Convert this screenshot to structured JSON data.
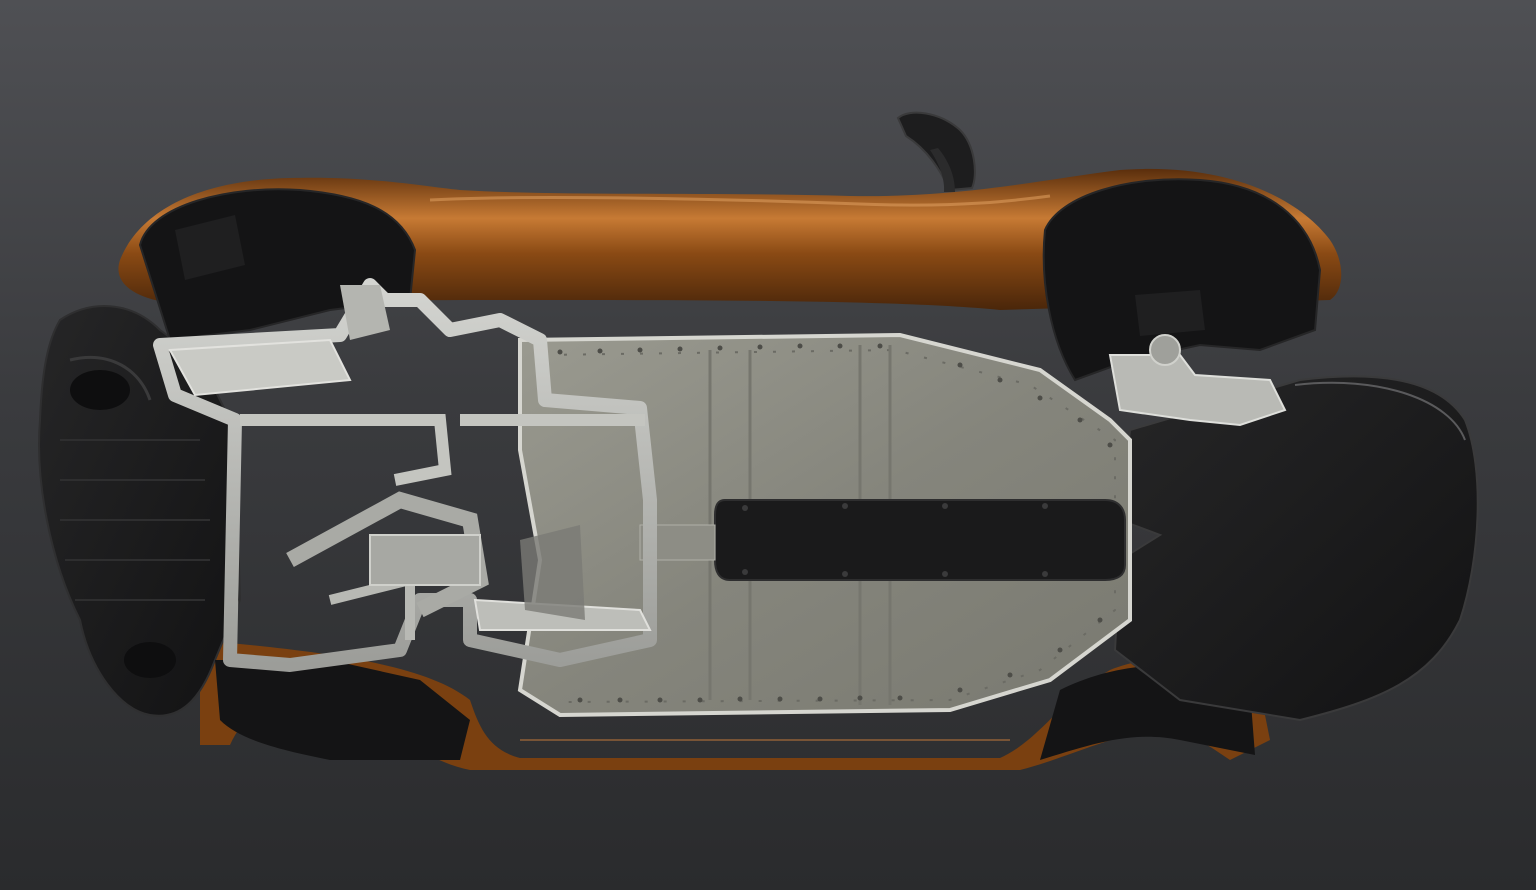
{
  "scene": {
    "subject": "car-underside-render",
    "colors": {
      "background_top": "#4f5054",
      "background_bottom": "#2a2b2d",
      "body_paint": "#8a4a14",
      "body_paint_highlight": "#c97a32",
      "floor_panel": "#8f8f86",
      "frame_metal": "#b9bab5",
      "carbon_black": "#1b1b1c",
      "wheel_well": "#141415"
    }
  }
}
